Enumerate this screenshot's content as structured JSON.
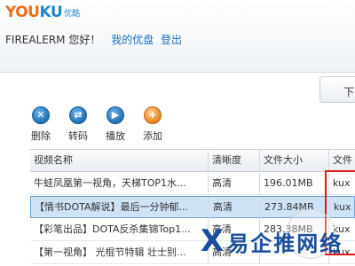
{
  "header": {
    "logo_main_1": "YOU",
    "logo_main_2": "KU",
    "logo_cn": "优酷",
    "username": "FIREALERM",
    "greeting": "您好！",
    "link_my": "我的优盘",
    "link_logout": "登出",
    "download_tab": "下"
  },
  "toolbar": {
    "delete": "删除",
    "convert": "转码",
    "play": "播放",
    "add": "添加"
  },
  "table": {
    "columns": [
      "视频名称",
      "清晰度",
      "文件大小",
      "文件"
    ],
    "rows": [
      {
        "name": "牛蛙凤凰第一视角，天梯TOP1水...",
        "definition": "高清",
        "size": "196.01MB",
        "format": "kux"
      },
      {
        "name": "【情书DOTA解说】最后一分钟郁...",
        "definition": "高清",
        "size": "273.84MB",
        "format": "kux"
      },
      {
        "name": "【彩笔出品】DOTA反杀集锦Top1...",
        "definition": "高清",
        "size": "283.38MB",
        "format": "kux"
      },
      {
        "name": "【第一视角】 光棍节特辑 壮士别...",
        "definition": "高清",
        "size": "",
        "format": "kux"
      }
    ]
  },
  "watermark": {
    "mark": "X",
    "text": "易企推网络"
  },
  "colors": {
    "accent_blue": "#1f6fb8",
    "logo_orange": "#ec6d1b",
    "selection": "#cfe3f7",
    "highlight_red": "#e01818"
  }
}
